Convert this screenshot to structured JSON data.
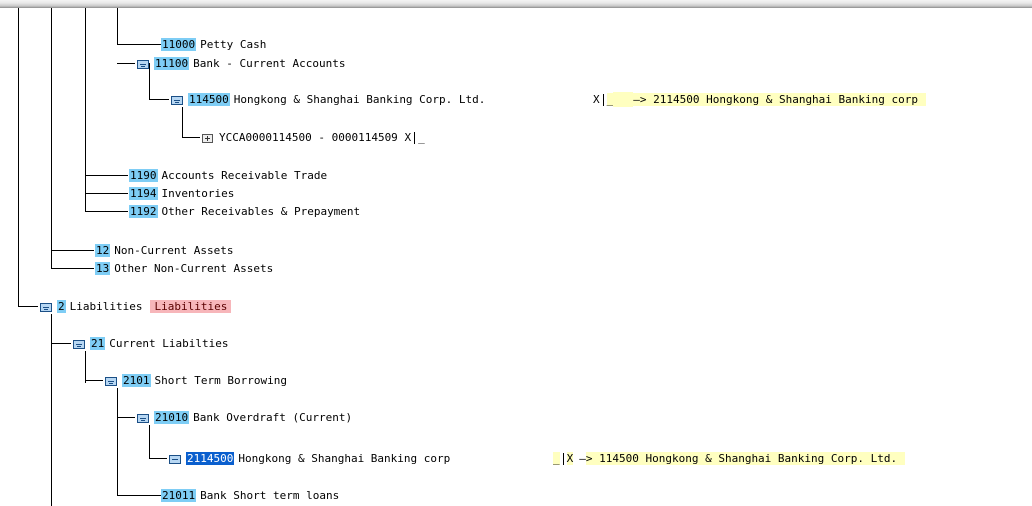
{
  "tree": {
    "petty_cash": {
      "code": "11000",
      "label": "Petty Cash"
    },
    "bank_current": {
      "code": "11100",
      "label": "Bank - Current Accounts"
    },
    "hsbc_asset": {
      "code": "114500",
      "label": "Hongkong & Shanghai Banking Corp. Ltd.",
      "x_mark": "X",
      "blank": "_",
      "mapping": "> 2114500 Hongkong & Shanghai Banking corp"
    },
    "range_node": {
      "label": "YCCA0000114500 - 0000114509",
      "x_mark": "X",
      "blank": "_"
    },
    "ar_trade": {
      "code": "1190",
      "label": "Accounts Receivable Trade"
    },
    "inventories": {
      "code": "1194",
      "label": "Inventories"
    },
    "other_recv": {
      "code": "1192",
      "label": "Other Receivables & Prepayment"
    },
    "non_current": {
      "code": "12",
      "label": "Non-Current Assets"
    },
    "other_non_current": {
      "code": "13",
      "label": "Other Non-Current Assets"
    },
    "liabilities": {
      "code": "2",
      "label": "Liabilities",
      "tag": "Liabilities"
    },
    "current_liab": {
      "code": "21",
      "label": "Current Liabilties"
    },
    "short_term_borrowing": {
      "code": "2101",
      "label": "Short Term Borrowing"
    },
    "bank_overdraft": {
      "code": "21010",
      "label": "Bank Overdraft (Current)"
    },
    "hsbc_liab": {
      "code": "2114500",
      "label": "Hongkong & Shanghai Banking corp",
      "blank": "_",
      "x_mark": "X",
      "mapping": "> 114500 Hongkong & Shanghai Banking Corp. Ltd."
    },
    "bank_st_loans": {
      "code": "21011",
      "label": "Bank Short term loans"
    }
  },
  "colors": {
    "code_highlight": "#7ecdf5",
    "selected_highlight": "#0a5fce",
    "mapping_bg": "#ffffc0",
    "tag_bg": "#f7b6ba"
  }
}
